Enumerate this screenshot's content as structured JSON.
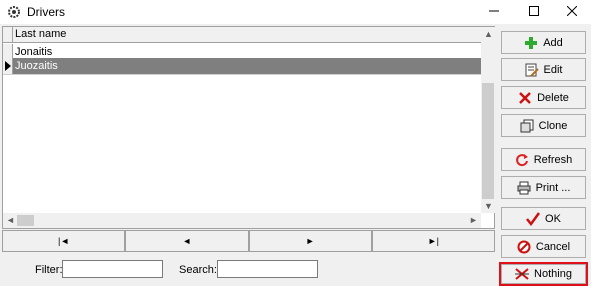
{
  "window": {
    "title": "Drivers"
  },
  "grid": {
    "column_header": "Last name",
    "rows": [
      {
        "last_name": "Jonaitis",
        "selected": false
      },
      {
        "last_name": "Juozaitis",
        "selected": true
      }
    ]
  },
  "navigator": {
    "buttons": [
      {
        "name": "first",
        "glyph": "|◄"
      },
      {
        "name": "prior",
        "glyph": "◄"
      },
      {
        "name": "next",
        "glyph": "►"
      },
      {
        "name": "last",
        "glyph": "►|"
      }
    ]
  },
  "filter": {
    "label": "Filter:",
    "value": ""
  },
  "search": {
    "label": "Search:",
    "value": ""
  },
  "actions": {
    "add": "Add",
    "edit": "Edit",
    "delete": "Delete",
    "clone": "Clone",
    "refresh": "Refresh",
    "print": "Print ...",
    "ok": "OK",
    "cancel": "Cancel",
    "nothing": "Nothing"
  },
  "colors": {
    "selection": "#7f7f7f",
    "highlight_border": "#e0101a",
    "add_icon": "#2eaa2e",
    "delete_icon": "#cc1111",
    "refresh_icon": "#dd2222",
    "ok_icon": "#cc1111"
  }
}
